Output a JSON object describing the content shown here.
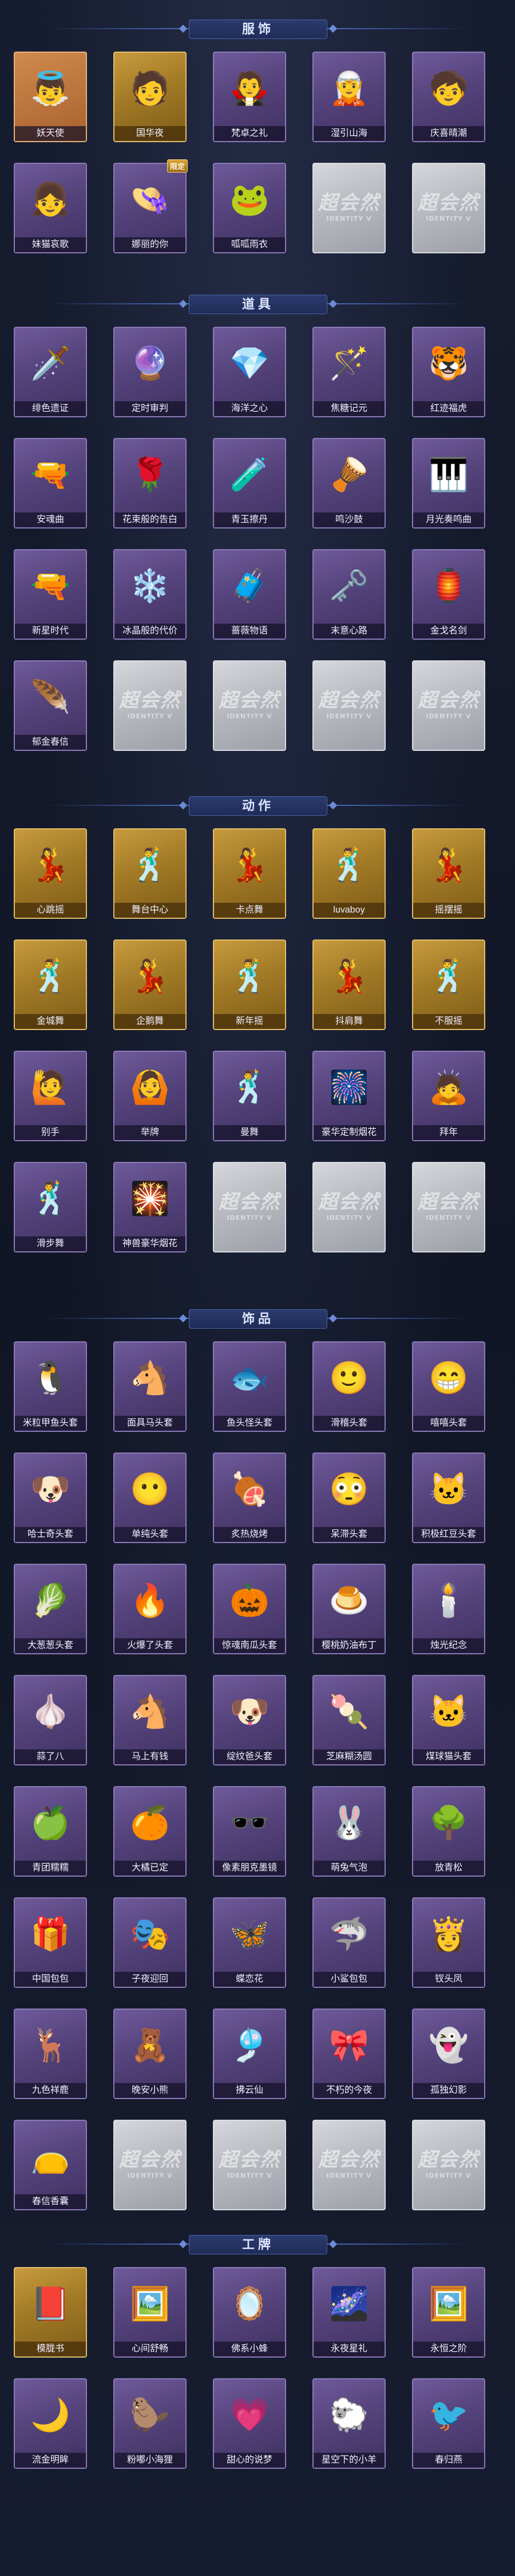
{
  "sections": [
    {
      "title": "服饰",
      "items": [
        {
          "label": "妖天使",
          "icon": "👼",
          "frame": "orange",
          "badge": ""
        },
        {
          "label": "国华夜",
          "icon": "🧑",
          "frame": "gold",
          "badge": ""
        },
        {
          "label": "梵卓之礼",
          "icon": "🧛",
          "frame": "purple",
          "badge": ""
        },
        {
          "label": "湿引山海",
          "icon": "🧝",
          "frame": "purple",
          "badge": ""
        },
        {
          "label": "庆喜晴潮",
          "icon": "🧒",
          "frame": "purple",
          "badge": ""
        },
        {
          "label": "妹猫哀歌",
          "icon": "👧",
          "frame": "purple",
          "badge": ""
        },
        {
          "label": "娜丽的你",
          "icon": "👒",
          "frame": "purple",
          "badge": "限定"
        },
        {
          "label": "呱呱雨衣",
          "icon": "🐸",
          "frame": "purple",
          "badge": ""
        },
        {
          "placeholder": true,
          "ph_text": "超会然",
          "ph_sub": "IDENTITY V"
        },
        {
          "placeholder": true,
          "ph_text": "超会然",
          "ph_sub": "IDENTITY V"
        }
      ]
    },
    {
      "title": "道具",
      "items": [
        {
          "label": "绯色遗证",
          "icon": "🗡️",
          "frame": "purple"
        },
        {
          "label": "定时审判",
          "icon": "🔮",
          "frame": "purple"
        },
        {
          "label": "海洋之心",
          "icon": "💎",
          "frame": "purple"
        },
        {
          "label": "焦糖记元",
          "icon": "🪄",
          "frame": "purple"
        },
        {
          "label": "红迹福虎",
          "icon": "🐯",
          "frame": "purple"
        },
        {
          "label": "安魂曲",
          "icon": "🔫",
          "frame": "purple"
        },
        {
          "label": "花束般的告白",
          "icon": "🌹",
          "frame": "purple"
        },
        {
          "label": "青玉擦丹",
          "icon": "🧪",
          "frame": "purple"
        },
        {
          "label": "鸣沙鼓",
          "icon": "🪘",
          "frame": "purple"
        },
        {
          "label": "月光奏鸣曲",
          "icon": "🎹",
          "frame": "purple"
        },
        {
          "label": "新星时代",
          "icon": "🔫",
          "frame": "purple"
        },
        {
          "label": "冰晶般的代价",
          "icon": "❄️",
          "frame": "purple"
        },
        {
          "label": "蔷薇物语",
          "icon": "🧳",
          "frame": "purple"
        },
        {
          "label": "末意心路",
          "icon": "🗝️",
          "frame": "purple"
        },
        {
          "label": "金戈名剑",
          "icon": "🏮",
          "frame": "purple"
        },
        {
          "label": "郁金春信",
          "icon": "🪶",
          "frame": "purple"
        },
        {
          "placeholder": true,
          "ph_text": "超会然",
          "ph_sub": "IDENTITY V"
        },
        {
          "placeholder": true,
          "ph_text": "超会然",
          "ph_sub": "IDENTITY V"
        },
        {
          "placeholder": true,
          "ph_text": "超会然",
          "ph_sub": "IDENTITY V"
        },
        {
          "placeholder": true,
          "ph_text": "超会然",
          "ph_sub": "IDENTITY V"
        }
      ]
    },
    {
      "title": "动作",
      "items": [
        {
          "label": "心跳摇",
          "icon": "💃",
          "frame": "gold"
        },
        {
          "label": "舞台中心",
          "icon": "🕺",
          "frame": "gold"
        },
        {
          "label": "卡点舞",
          "icon": "💃",
          "frame": "gold"
        },
        {
          "label": "luvaboy",
          "icon": "🕺",
          "frame": "gold"
        },
        {
          "label": "摇摆摇",
          "icon": "💃",
          "frame": "gold"
        },
        {
          "label": "金城舞",
          "icon": "🕺",
          "frame": "gold"
        },
        {
          "label": "企鹅舞",
          "icon": "💃",
          "frame": "gold"
        },
        {
          "label": "新年摇",
          "icon": "🕺",
          "frame": "gold"
        },
        {
          "label": "抖肩舞",
          "icon": "💃",
          "frame": "gold"
        },
        {
          "label": "不服摇",
          "icon": "🕺",
          "frame": "gold"
        },
        {
          "label": "别手",
          "icon": "🙋",
          "frame": "purple"
        },
        {
          "label": "举牌",
          "icon": "🙆",
          "frame": "purple"
        },
        {
          "label": "曼舞",
          "icon": "🕺",
          "frame": "purple"
        },
        {
          "label": "豪华定制烟花",
          "icon": "🎆",
          "frame": "purple"
        },
        {
          "label": "拜年",
          "icon": "🙇",
          "frame": "purple"
        },
        {
          "label": "滑步舞",
          "icon": "🕺",
          "frame": "purple"
        },
        {
          "label": "神兽豪华烟花",
          "icon": "🎇",
          "frame": "purple"
        },
        {
          "placeholder": true,
          "ph_text": "超会然",
          "ph_sub": "IDENTITY V"
        },
        {
          "placeholder": true,
          "ph_text": "超会然",
          "ph_sub": "IDENTITY V"
        },
        {
          "placeholder": true,
          "ph_text": "超会然",
          "ph_sub": "IDENTITY V"
        }
      ]
    },
    {
      "title": "饰品",
      "items": [
        {
          "label": "米粒甲鱼头套",
          "icon": "🐧",
          "frame": "purple"
        },
        {
          "label": "面具马头套",
          "icon": "🐴",
          "frame": "purple"
        },
        {
          "label": "鱼头怪头套",
          "icon": "🐟",
          "frame": "purple"
        },
        {
          "label": "滑稽头套",
          "icon": "🙂",
          "frame": "purple"
        },
        {
          "label": "嘻嘻头套",
          "icon": "😁",
          "frame": "purple"
        },
        {
          "label": "哈士奇头套",
          "icon": "🐶",
          "frame": "purple"
        },
        {
          "label": "单纯头套",
          "icon": "😶",
          "frame": "purple"
        },
        {
          "label": "炙热烧烤",
          "icon": "🍖",
          "frame": "purple"
        },
        {
          "label": "呆滞头套",
          "icon": "😳",
          "frame": "purple"
        },
        {
          "label": "积极红豆头套",
          "icon": "🐱",
          "frame": "purple"
        },
        {
          "label": "大葱葱头套",
          "icon": "🥬",
          "frame": "purple"
        },
        {
          "label": "火爆了头套",
          "icon": "🔥",
          "frame": "purple"
        },
        {
          "label": "惊魂南瓜头套",
          "icon": "🎃",
          "frame": "purple"
        },
        {
          "label": "樱桃奶油布丁",
          "icon": "🍮",
          "frame": "purple"
        },
        {
          "label": "烛光纪念",
          "icon": "🕯️",
          "frame": "purple"
        },
        {
          "label": "蒜了八",
          "icon": "🧄",
          "frame": "purple"
        },
        {
          "label": "马上有钱",
          "icon": "🐴",
          "frame": "purple"
        },
        {
          "label": "绽纹爸头套",
          "icon": "🐶",
          "frame": "purple"
        },
        {
          "label": "芝麻糊汤圆",
          "icon": "🍡",
          "frame": "purple"
        },
        {
          "label": "煤球猫头套",
          "icon": "🐱",
          "frame": "purple"
        },
        {
          "label": "青团糯糯",
          "icon": "🍏",
          "frame": "purple"
        },
        {
          "label": "大橘已定",
          "icon": "🍊",
          "frame": "purple"
        },
        {
          "label": "像素朋克墨镜",
          "icon": "🕶️",
          "frame": "purple"
        },
        {
          "label": "萌兔气泡",
          "icon": "🐰",
          "frame": "purple"
        },
        {
          "label": "放青松",
          "icon": "🌳",
          "frame": "purple"
        },
        {
          "label": "中国包包",
          "icon": "🎁",
          "frame": "purple"
        },
        {
          "label": "子夜迎回",
          "icon": "🎭",
          "frame": "purple"
        },
        {
          "label": "蝶恋花",
          "icon": "🦋",
          "frame": "purple"
        },
        {
          "label": "小鲨包包",
          "icon": "🦈",
          "frame": "purple"
        },
        {
          "label": "钗头凤",
          "icon": "👸",
          "frame": "purple"
        },
        {
          "label": "九色祥鹿",
          "icon": "🦌",
          "frame": "purple"
        },
        {
          "label": "晚安小熊",
          "icon": "🧸",
          "frame": "purple"
        },
        {
          "label": "拂云仙",
          "icon": "🎐",
          "frame": "purple"
        },
        {
          "label": "不朽的今夜",
          "icon": "🎀",
          "frame": "purple"
        },
        {
          "label": "孤独幻影",
          "icon": "👻",
          "frame": "purple"
        },
        {
          "label": "春信香囊",
          "icon": "👝",
          "frame": "purple"
        },
        {
          "placeholder": true,
          "ph_text": "超会然",
          "ph_sub": "IDENTITY V"
        },
        {
          "placeholder": true,
          "ph_text": "超会然",
          "ph_sub": "IDENTITY V"
        },
        {
          "placeholder": true,
          "ph_text": "超会然",
          "ph_sub": "IDENTITY V"
        },
        {
          "placeholder": true,
          "ph_text": "超会然",
          "ph_sub": "IDENTITY V"
        }
      ]
    },
    {
      "title": "工牌",
      "items": [
        {
          "label": "模胧书",
          "icon": "📕",
          "frame": "gold"
        },
        {
          "label": "心间舒畅",
          "icon": "🖼️",
          "frame": "purple"
        },
        {
          "label": "佛系小蜂",
          "icon": "🪞",
          "frame": "purple"
        },
        {
          "label": "永夜星礼",
          "icon": "🌌",
          "frame": "purple"
        },
        {
          "label": "永恒之阶",
          "icon": "🖼️",
          "frame": "purple"
        },
        {
          "label": "流金明眸",
          "icon": "🌙",
          "frame": "purple"
        },
        {
          "label": "粉嘟小海狸",
          "icon": "🦫",
          "frame": "purple"
        },
        {
          "label": "甜心的说梦",
          "icon": "💗",
          "frame": "purple"
        },
        {
          "label": "星空下的小羊",
          "icon": "🐑",
          "frame": "purple"
        },
        {
          "label": "春归燕",
          "icon": "🐦",
          "frame": "purple"
        }
      ]
    }
  ]
}
